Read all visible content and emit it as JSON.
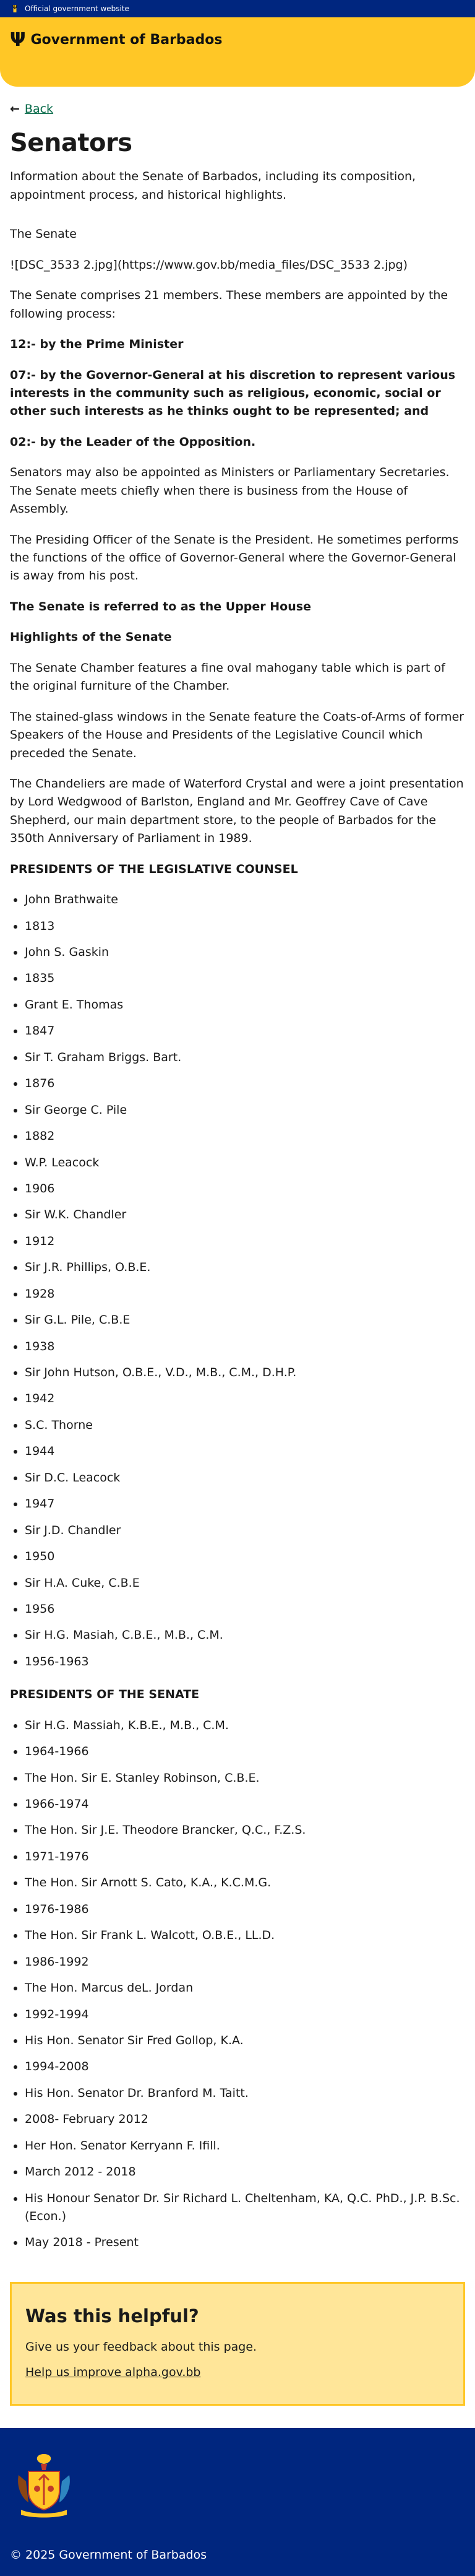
{
  "topbar": {
    "label": "Official government website"
  },
  "header": {
    "title": "Government of Barbados"
  },
  "nav": {
    "back_label": "Back"
  },
  "page": {
    "title": "Senators",
    "intro": "Information about the Senate of Barbados, including its composition, appointment process, and historical highlights.",
    "section_heading": "The Senate",
    "image_markdown": "![DSC_3533 2.jpg](https://www.gov.bb/media_files/DSC_3533 2.jpg)",
    "composition": "The Senate comprises 21 members. These members are appointed by the following process:",
    "appoint_pm": "12:- by the Prime Minister",
    "appoint_gg": "07:- by the Governor-General at his discretion to represent various interests in the community such as religious, economic, social or other such interests as he thinks ought to be represented; and",
    "appoint_opp": "02:- by the Leader of the Opposition.",
    "ministers": "Senators may also be appointed as Ministers or Parliamentary Secretaries. The Senate meets chiefly when there is business from the House of Assembly.",
    "presiding": "The Presiding Officer of the Senate is the President. He sometimes performs the functions of the office of Governor-General where the Governor-General is away from his post.",
    "upper_house": "The Senate is referred to as the Upper House",
    "highlights_heading": "Highlights of the Senate",
    "highlight_table": "The Senate Chamber features a fine oval mahogany table which is part of the original furniture of the Chamber.",
    "highlight_windows": "The stained-glass windows in the Senate feature the Coats-of-Arms of former Speakers of the House and Presidents of the Legislative Council which preceded the Senate.",
    "highlight_chandeliers": "The Chandeliers are made of Waterford Crystal and were a joint presentation by Lord Wedgwood of Barlston, England and Mr. Geoffrey Cave of Cave Shepherd, our main department store, to the people of Barbados for the 350th Anniversary of Parliament in 1989.",
    "legislative_heading": "PRESIDENTS OF THE LEGISLATIVE COUNSEL",
    "legislative_list": [
      "John Brathwaite",
      "1813",
      "John S. Gaskin",
      "1835",
      "Grant E. Thomas",
      "1847",
      "Sir T. Graham Briggs. Bart.",
      "1876",
      "Sir George C. Pile",
      "1882",
      "W.P. Leacock",
      "1906",
      "Sir W.K. Chandler",
      "1912",
      "Sir J.R. Phillips, O.B.E.",
      "1928",
      "Sir G.L. Pile, C.B.E",
      "1938",
      "Sir John Hutson, O.B.E., V.D., M.B., C.M., D.H.P.",
      "1942",
      "S.C. Thorne",
      "1944",
      "Sir D.C. Leacock",
      "1947",
      "Sir J.D. Chandler",
      "1950",
      "Sir H.A. Cuke, C.B.E",
      "1956",
      "Sir H.G. Masiah, C.B.E., M.B., C.M.",
      "1956-1963"
    ],
    "senate_heading": "PRESIDENTS OF THE SENATE",
    "senate_list": [
      "Sir H.G. Massiah, K.B.E., M.B., C.M.",
      "1964-1966",
      "The Hon. Sir E. Stanley Robinson, C.B.E.",
      "1966-1974",
      "The Hon. Sir J.E. Theodore Brancker, Q.C., F.Z.S.",
      "1971-1976",
      "The Hon. Sir Arnott S. Cato, K.A., K.C.M.G.",
      "1976-1986",
      "The Hon. Sir Frank L. Walcott, O.B.E., LL.D.",
      "1986-1992",
      "The Hon. Marcus deL. Jordan",
      "1992-1994",
      "His Hon. Senator Sir Fred Gollop, K.A.",
      "1994-2008",
      "His Hon. Senator Dr. Branford M. Taitt.",
      "2008- February 2012",
      "Her Hon. Senator Kerryann F. Ifill.",
      "March 2012 - 2018",
      "His Honour Senator Dr. Sir Richard L. Cheltenham, KA, Q.C. PhD., J.P. B.Sc. (Econ.)",
      "May 2018 - Present"
    ]
  },
  "feedback": {
    "title": "Was this helpful?",
    "text": "Give us your feedback about this page.",
    "link": "Help us improve alpha.gov.bb"
  },
  "footer": {
    "copyright": "© 2025 Government of Barbados"
  }
}
